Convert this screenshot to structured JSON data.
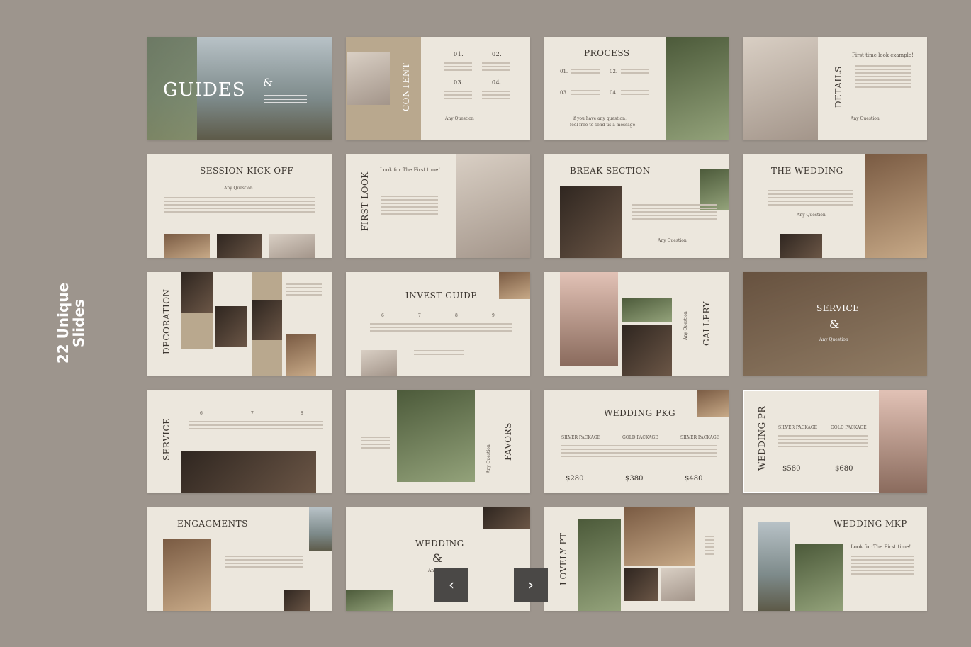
{
  "side_title": {
    "line1": "22 Unique",
    "line2": "Slides"
  },
  "slides": {
    "guides": {
      "title": "GUIDES",
      "amp": "&"
    },
    "content": {
      "title": "CONTENT",
      "n1": "01.",
      "n2": "02.",
      "n3": "03.",
      "n4": "04.",
      "any_q": "Any Question"
    },
    "process": {
      "title": "PROCESS",
      "n1": "01.",
      "n2": "02.",
      "n3": "03.",
      "n4": "04.",
      "note1": "if you have any question,",
      "note2": "feel free to send us a message!"
    },
    "details": {
      "title": "DETAILS",
      "subtitle": "First time look example!",
      "any_q": "Any Question"
    },
    "session": {
      "title": "SESSION KICK OFF",
      "subtitle": "Any Question"
    },
    "first_look": {
      "title": "FIRST LOOK",
      "subtitle": "Look for The First time!"
    },
    "break_section": {
      "title": "BREAK SECTION",
      "any_q": "Any Question"
    },
    "the_wedding": {
      "title": "THE WEDDING",
      "any_q": "Any Question"
    },
    "decoration": {
      "title": "DECORATION"
    },
    "invest_guide": {
      "title": "INVEST GUIDE",
      "n1": "6",
      "n2": "7",
      "n3": "8",
      "n4": "9"
    },
    "gallery": {
      "title": "GALLERY",
      "any_q": "Any Question"
    },
    "service_amp": {
      "title": "SERVICE",
      "amp": "&",
      "any_q": "Any Question"
    },
    "service": {
      "title": "SERVICE",
      "n1": "6",
      "n2": "7",
      "n3": "8"
    },
    "favors": {
      "title": "FAVORS",
      "any_q": "Any Question"
    },
    "wedding_pkg": {
      "title": "WEDDING PKG",
      "p1": "$280",
      "p2": "$380",
      "p3": "$480",
      "k1": "SILVER PACKAGE",
      "k2": "GOLD PACKAGE",
      "k3": "SILVER PACKAGE"
    },
    "wedding_pr": {
      "title": "WEDDING PR",
      "p1": "$580",
      "p2": "$680",
      "k1": "SILVER PACKAGE",
      "k2": "GOLD PACKAGE"
    },
    "engagments": {
      "title": "ENGAGMENTS"
    },
    "wedding_amp": {
      "title": "WEDDING",
      "amp": "&",
      "any_q": "Any Question"
    },
    "lovely_pt": {
      "title": "LOVELY PT"
    },
    "wedding_mkp": {
      "title": "WEDDING MKP",
      "subtitle": "Look for The First time!"
    }
  },
  "nav": {
    "prev_icon": "chevron-left-icon",
    "next_icon": "chevron-right-icon",
    "prev_glyph": "‹",
    "next_glyph": "›"
  }
}
